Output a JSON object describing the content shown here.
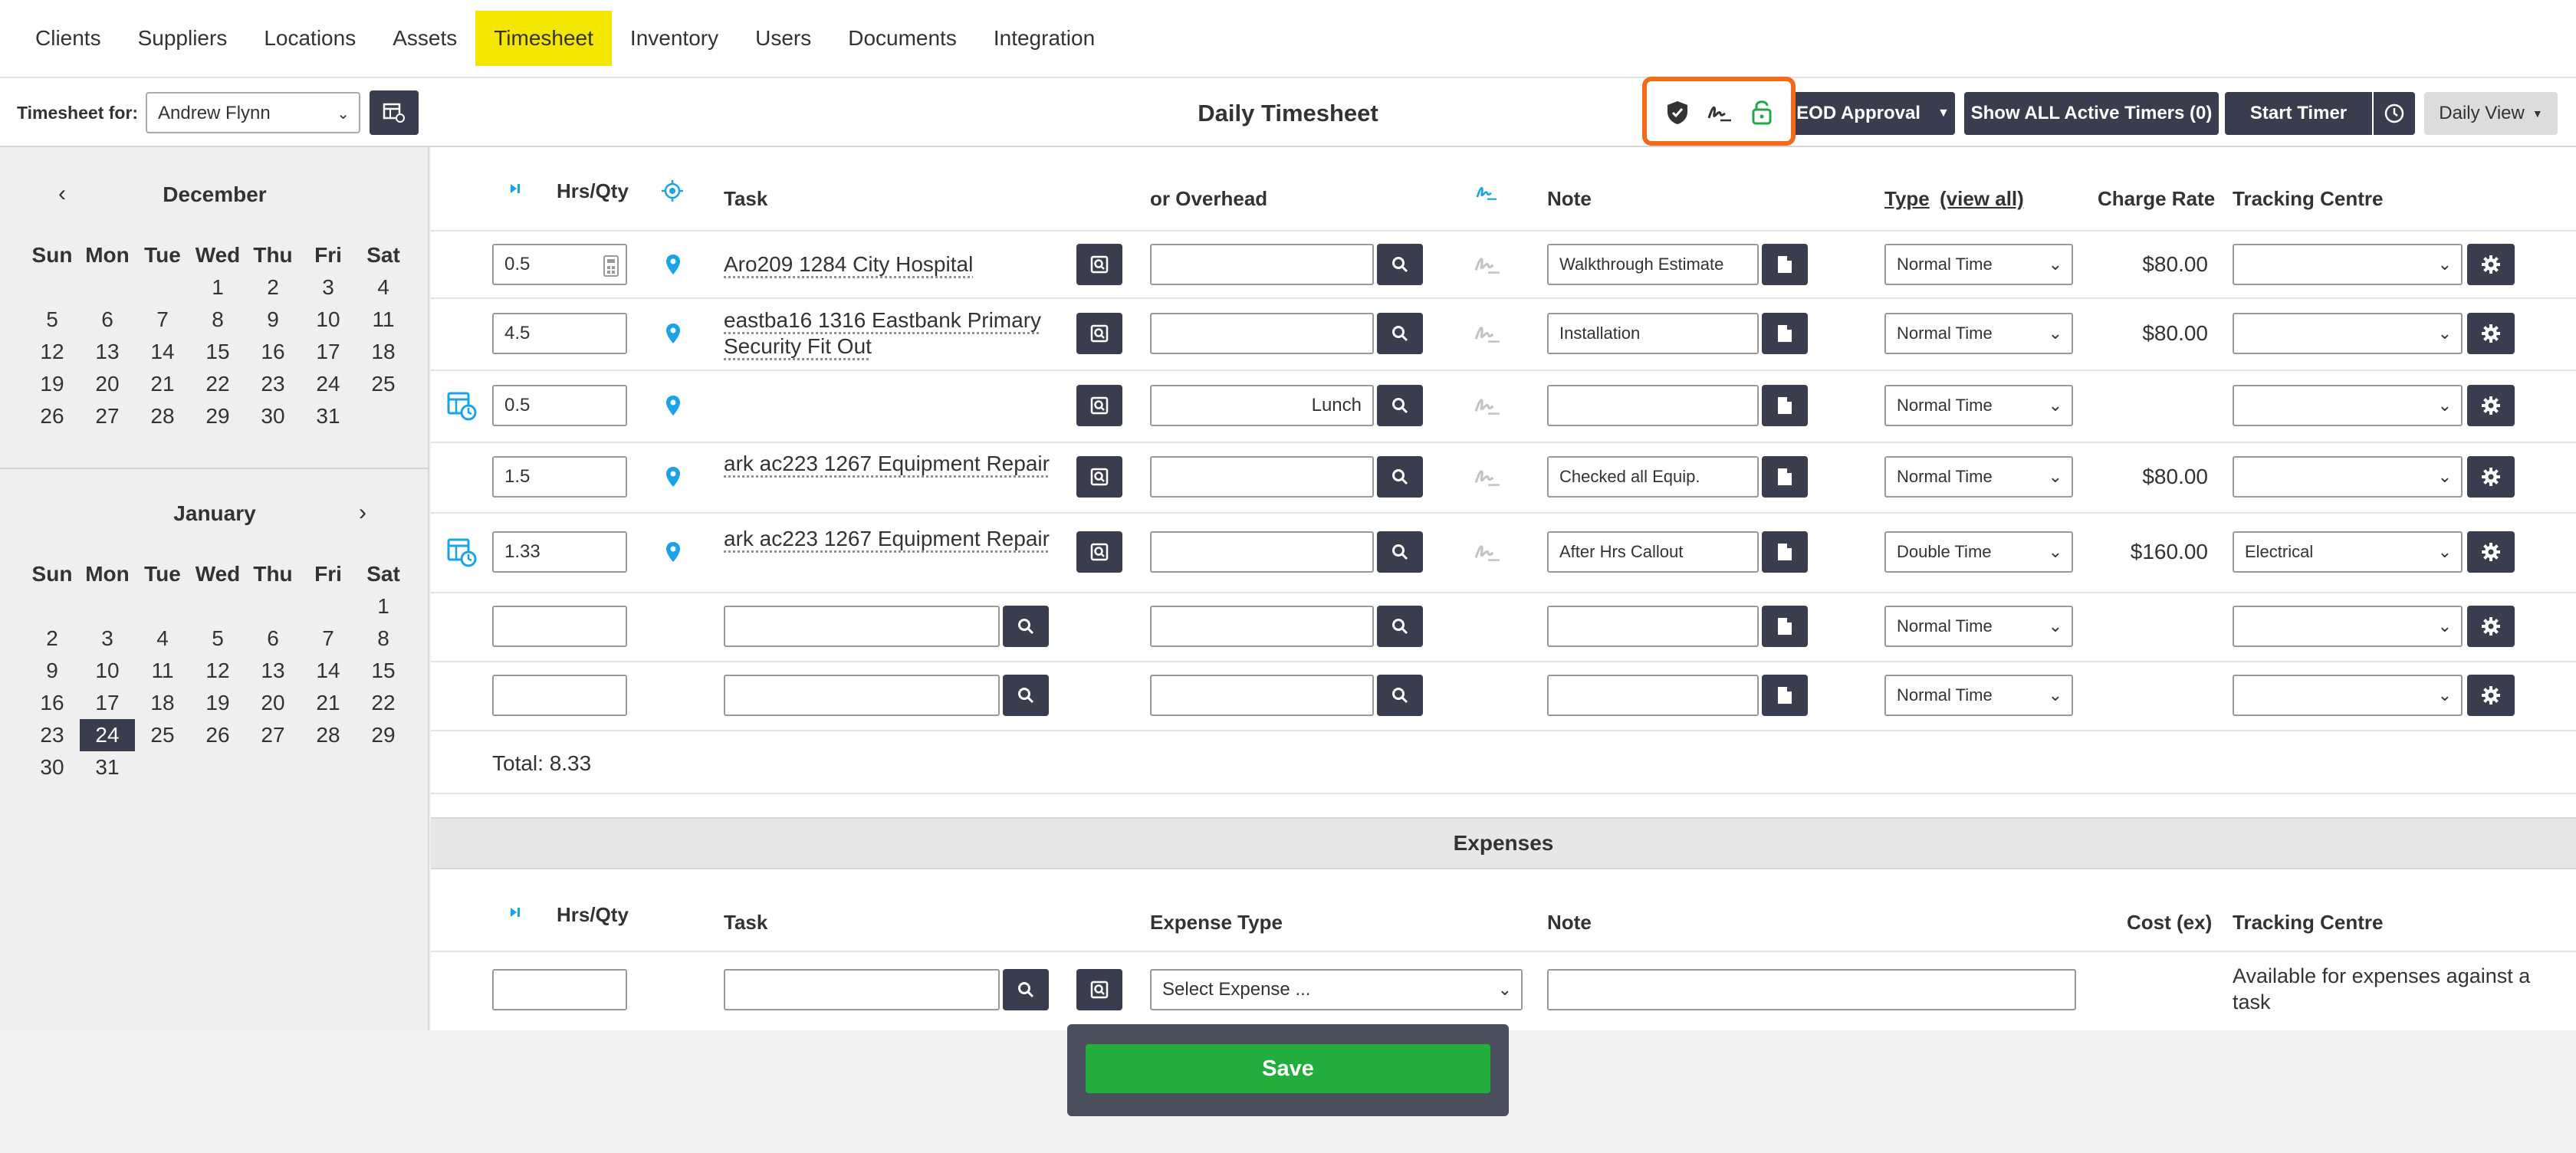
{
  "nav": {
    "items": [
      {
        "label": "Clients"
      },
      {
        "label": "Suppliers"
      },
      {
        "label": "Locations"
      },
      {
        "label": "Assets"
      },
      {
        "label": "Timesheet"
      },
      {
        "label": "Inventory"
      },
      {
        "label": "Users"
      },
      {
        "label": "Documents"
      },
      {
        "label": "Integration"
      }
    ],
    "active": "Timesheet",
    "active_color": "#f3e600"
  },
  "toolbar": {
    "timesheet_for_label": "Timesheet for:",
    "timesheet_for_value": "Andrew Flynn",
    "title": "Daily Timesheet",
    "eod_label": "EOD Approval",
    "show_timers_label": "Show ALL Active Timers (0)",
    "start_timer_label": "Start Timer",
    "daily_view_label": "Daily View",
    "highlight_color": "#f26a1b"
  },
  "calendar": {
    "weekdays": [
      "Sun",
      "Mon",
      "Tue",
      "Wed",
      "Thu",
      "Fri",
      "Sat"
    ],
    "months": [
      {
        "name": "December",
        "prev": "‹",
        "days": [
          "",
          "",
          "",
          "1",
          "2",
          "3",
          "4",
          "5",
          "6",
          "7",
          "8",
          "9",
          "10",
          "11",
          "12",
          "13",
          "14",
          "15",
          "16",
          "17",
          "18",
          "19",
          "20",
          "21",
          "22",
          "23",
          "24",
          "25",
          "26",
          "27",
          "28",
          "29",
          "30",
          "31",
          ""
        ]
      },
      {
        "name": "January",
        "next": "›",
        "days": [
          "",
          "",
          "",
          "",
          "",
          "",
          "1",
          "2",
          "3",
          "4",
          "5",
          "6",
          "7",
          "8",
          "9",
          "10",
          "11",
          "12",
          "13",
          "14",
          "15",
          "16",
          "17",
          "18",
          "19",
          "20",
          "21",
          "22",
          "23",
          "24",
          "25",
          "26",
          "27",
          "28",
          "29",
          "30",
          "31",
          "",
          "",
          "",
          "",
          ""
        ],
        "selected": "24"
      }
    ]
  },
  "table": {
    "headers": {
      "hrs": "Hrs/Qty",
      "task": "Task",
      "overhead": "or Overhead",
      "note": "Note",
      "type": "Type",
      "view_all": "(view all)",
      "charge_rate": "Charge Rate",
      "tracking": "Tracking Centre"
    },
    "rows": [
      {
        "hrs": "0.5",
        "task": "Aro209  1284  City Hospital",
        "overhead": "",
        "note": "Walkthrough Estimate",
        "type": "Normal Time",
        "rate": "$80.00",
        "tracking": ""
      },
      {
        "hrs": "4.5",
        "task": "eastba16  1316  Eastbank Primary Security Fit Out",
        "overhead": "",
        "note": "Installation",
        "type": "Normal Time",
        "rate": "$80.00",
        "tracking": ""
      },
      {
        "hrs": "0.5",
        "task": "",
        "overhead": "Lunch",
        "note": "",
        "type": "Normal Time",
        "rate": "",
        "tracking": ""
      },
      {
        "hrs": "1.5",
        "task": "ark ac223  1267  Equipment Repair",
        "overhead": "",
        "note": "Checked all Equip.",
        "type": "Normal Time",
        "rate": "$80.00",
        "tracking": ""
      },
      {
        "hrs": "1.33",
        "task": "ark ac223  1267  Equipment Repair",
        "overhead": "",
        "note": "After Hrs Callout",
        "type": "Double Time",
        "rate": "$160.00",
        "tracking": "Electrical"
      },
      {
        "hrs": "",
        "task": "",
        "overhead": "",
        "note": "",
        "type": "Normal Time",
        "rate": "",
        "tracking": ""
      },
      {
        "hrs": "",
        "task": "",
        "overhead": "",
        "note": "",
        "type": "Normal Time",
        "rate": "",
        "tracking": ""
      }
    ],
    "total": "Total: 8.33"
  },
  "expenses": {
    "band": "Expenses",
    "headers": {
      "hrs": "Hrs/Qty",
      "task": "Task",
      "type": "Expense Type",
      "note": "Note",
      "cost": "Cost (ex)",
      "tracking": "Tracking Centre"
    },
    "type_placeholder": "Select Expense ...",
    "tracking_note": "Available for expenses against a task"
  },
  "save_label": "Save",
  "accent": "#1aa3e8",
  "save_color": "#22ad3c"
}
